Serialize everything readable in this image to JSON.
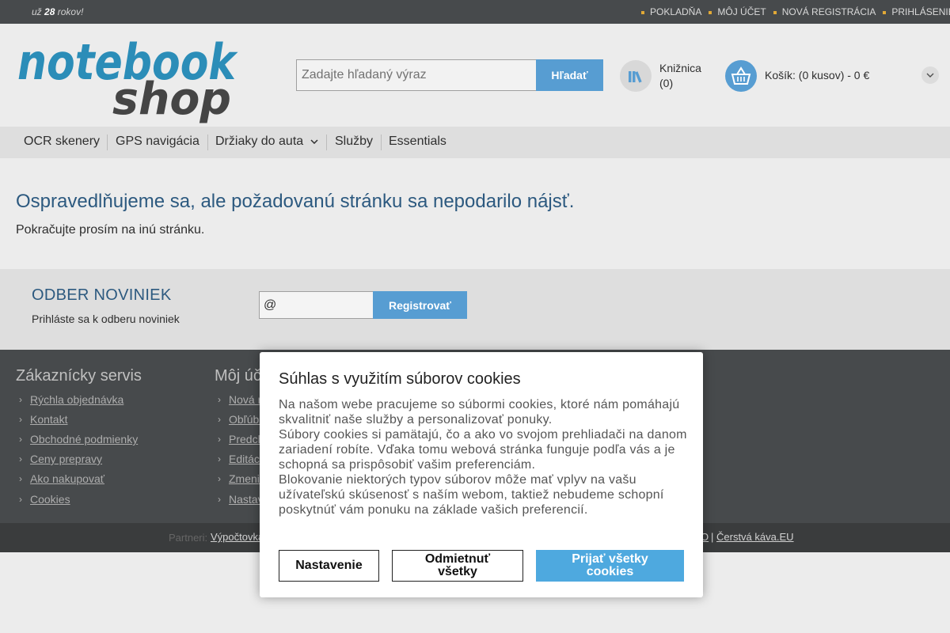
{
  "topbar": {
    "tagline_prefix": "už",
    "tagline_years": "28",
    "tagline_suffix": "rokov!",
    "links": [
      "POKLADŇA",
      "MÔJ ÚČET",
      "NOVÁ REGISTRÁCIA",
      "PRIHLÁSENIE"
    ]
  },
  "header": {
    "logo_top": "notebook",
    "logo_bottom": "shop",
    "search_placeholder": "Zadajte hľadaný výraz",
    "search_button": "Hľadať",
    "library_label": "Knižnica",
    "library_count": "(0)",
    "cart_label": "Košík: (0 kusov) - 0 €"
  },
  "nav": {
    "items": [
      "OCR skenery",
      "GPS navigácia",
      "Držiaky do auta",
      "Služby",
      "Essentials"
    ]
  },
  "error": {
    "title": "Ospravedlňujeme sa, ale požadovanú stránku sa nepodarilo nájsť.",
    "subtitle": "Pokračujte prosím na inú stránku."
  },
  "newsletter": {
    "title": "ODBER NOVINIEK",
    "subtitle": "Prihláste sa k odberu noviniek",
    "input_value": "@",
    "button": "Registrovať"
  },
  "footer": {
    "col1": {
      "title": "Zákaznícky servis",
      "links": [
        "Rýchla objednávka",
        "Kontakt",
        "Obchodné podmienky",
        "Ceny prepravy",
        "Ako nakupovať",
        "Cookies"
      ]
    },
    "col2": {
      "title": "Môj úč",
      "links": [
        "Nová r",
        "Obľúbe",
        "Predch",
        "Editác",
        "Zmeni",
        "Nastav"
      ]
    },
    "partners_label": "Partneri:",
    "partners_left": "Výpočtovka",
    "partners_mid": "O",
    "partners_sep": "|",
    "partners_right": "Čerstvá káva.EU"
  },
  "cookie_modal": {
    "title": "Súhlas s využitím súborov cookies",
    "paragraphs": [
      "Na našom webe pracujeme so súbormi cookies, ktoré nám pomáhajú skvalitniť naše služby a personalizovať ponuky.",
      "Súbory cookies si pamätajú, čo a ako vo svojom prehliadači na danom zariadení robíte. Vďaka tomu webová stránka funguje podľa vás a je schopná sa prispôsobiť vašim preferenciám.",
      "Blokovanie niektorých typov súborov môže mať vplyv na vašu užívateľskú skúsenosť s naším webom, taktiež nebudeme schopní poskytnúť vám ponuku na základe vašich preferencií."
    ],
    "btn_settings": "Nastavenie",
    "btn_reject_line1": "Odmietnuť",
    "btn_reject_line2": "všetky",
    "btn_accept_line1": "Prijať všetky",
    "btn_accept_line2": "cookies"
  },
  "colors": {
    "topbar": "#3c3f41",
    "accent_blue": "#4d97d0",
    "heading_blue": "#1f4f78",
    "footer": "#3c3f41"
  }
}
